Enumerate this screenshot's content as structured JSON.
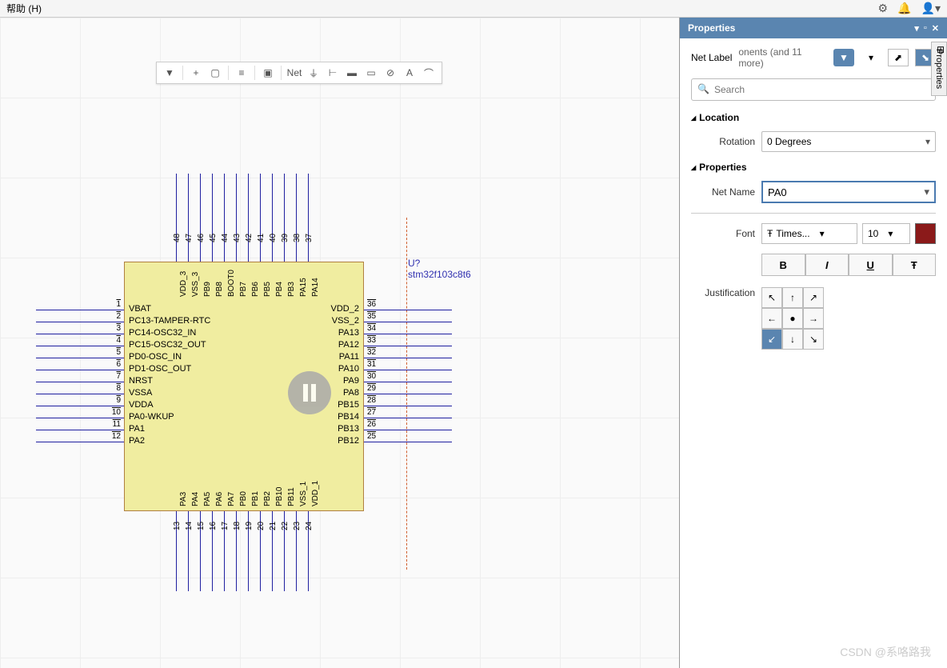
{
  "menu": {
    "help": "帮助 (H)"
  },
  "toolbar_icons": [
    "▼",
    "+",
    "▢",
    "≡",
    "▣",
    "Net",
    "⏚",
    "⊢",
    "▬",
    "▭",
    "⊘",
    "A",
    "⌒"
  ],
  "canvas": {
    "designator": "U?",
    "part": "stm32f103c8t6",
    "left_pins": [
      {
        "n": "1",
        "name": "VBAT"
      },
      {
        "n": "2",
        "name": "PC13-TAMPER-RTC"
      },
      {
        "n": "3",
        "name": "PC14-OSC32_IN"
      },
      {
        "n": "4",
        "name": "PC15-OSC32_OUT"
      },
      {
        "n": "5",
        "name": "PD0-OSC_IN"
      },
      {
        "n": "6",
        "name": "PD1-OSC_OUT"
      },
      {
        "n": "7",
        "name": "NRST"
      },
      {
        "n": "8",
        "name": "VSSA"
      },
      {
        "n": "9",
        "name": "VDDA"
      },
      {
        "n": "10",
        "name": "PA0-WKUP"
      },
      {
        "n": "11",
        "name": "PA1"
      },
      {
        "n": "12",
        "name": "PA2"
      }
    ],
    "right_pins": [
      {
        "n": "36",
        "name": "VDD_2"
      },
      {
        "n": "35",
        "name": "VSS_2"
      },
      {
        "n": "34",
        "name": "PA13"
      },
      {
        "n": "33",
        "name": "PA12"
      },
      {
        "n": "32",
        "name": "PA11"
      },
      {
        "n": "31",
        "name": "PA10"
      },
      {
        "n": "30",
        "name": "PA9"
      },
      {
        "n": "29",
        "name": "PA8"
      },
      {
        "n": "28",
        "name": "PB15"
      },
      {
        "n": "27",
        "name": "PB14"
      },
      {
        "n": "26",
        "name": "PB13"
      },
      {
        "n": "25",
        "name": "PB12"
      }
    ],
    "top_pins": [
      {
        "n": "48",
        "name": "VDD_3"
      },
      {
        "n": "47",
        "name": "VSS_3"
      },
      {
        "n": "46",
        "name": "PB9"
      },
      {
        "n": "45",
        "name": "PB8"
      },
      {
        "n": "44",
        "name": "BOOT0"
      },
      {
        "n": "43",
        "name": "PB7"
      },
      {
        "n": "42",
        "name": "PB6"
      },
      {
        "n": "41",
        "name": "PB5"
      },
      {
        "n": "40",
        "name": "PB4"
      },
      {
        "n": "39",
        "name": "PB3"
      },
      {
        "n": "38",
        "name": "PA15"
      },
      {
        "n": "37",
        "name": "PA14"
      }
    ],
    "bottom_pins": [
      {
        "n": "13",
        "name": "PA3"
      },
      {
        "n": "14",
        "name": "PA4"
      },
      {
        "n": "15",
        "name": "PA5"
      },
      {
        "n": "16",
        "name": "PA6"
      },
      {
        "n": "17",
        "name": "PA7"
      },
      {
        "n": "18",
        "name": "PB0"
      },
      {
        "n": "19",
        "name": "PB1"
      },
      {
        "n": "20",
        "name": "PB2"
      },
      {
        "n": "21",
        "name": "PB10"
      },
      {
        "n": "22",
        "name": "PB11"
      },
      {
        "n": "23",
        "name": "VSS_1"
      },
      {
        "n": "24",
        "name": "VDD_1"
      }
    ]
  },
  "panel": {
    "title": "Properties",
    "object_type": "Net Label",
    "filter_text": "onents (and 11 more)",
    "search_placeholder": "Search",
    "sections": {
      "location": "Location",
      "properties": "Properties"
    },
    "rotation_label": "Rotation",
    "rotation_value": "0 Degrees",
    "net_name_label": "Net Name",
    "net_name_value": "PA0",
    "font_label": "Font",
    "font_family": "Times...",
    "font_size": "10",
    "justification_label": "Justification",
    "just_arrows": [
      "↖",
      "↑",
      "↗",
      "←",
      "●",
      "→",
      "↙",
      "↓",
      "↘"
    ],
    "fmt": {
      "b": "B",
      "i": "I",
      "u": "U",
      "s": "Ŧ"
    }
  },
  "side_tab": "Properties",
  "watermark": "CSDN @系咯路我"
}
